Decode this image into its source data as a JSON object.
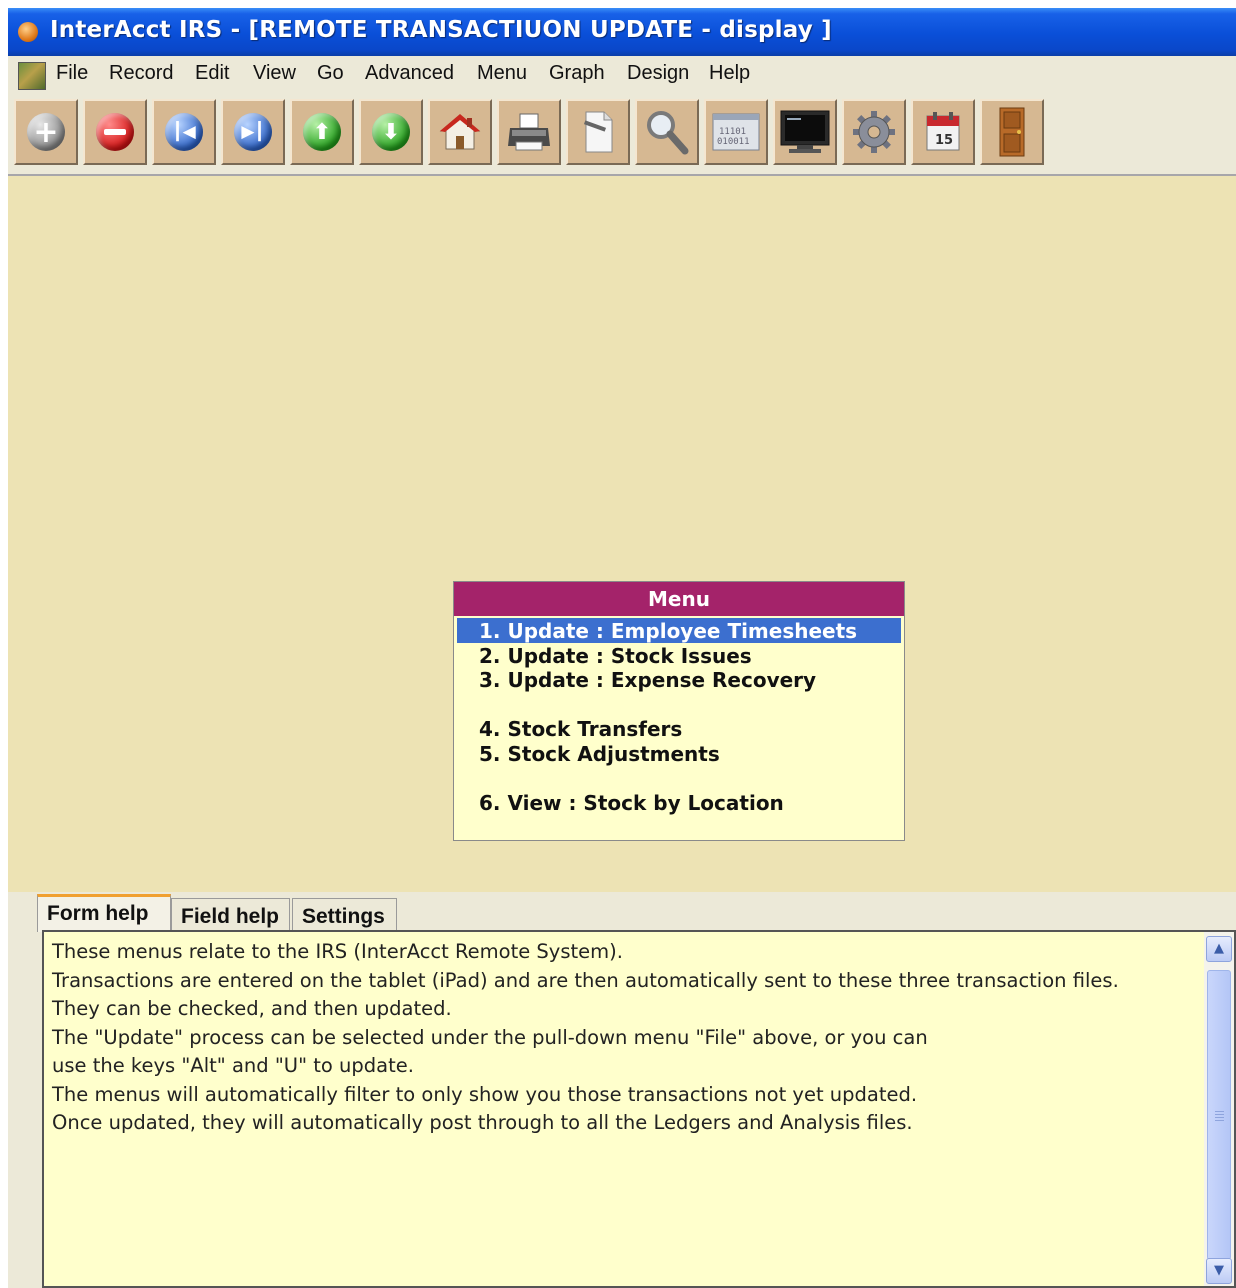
{
  "window": {
    "title": "InterAcct IRS - [REMOTE TRANSACTIUON UPDATE - display ]"
  },
  "menubar": {
    "items": [
      {
        "label": "File",
        "icon": null
      },
      {
        "label": "Record"
      },
      {
        "label": "Edit"
      },
      {
        "label": "View"
      },
      {
        "label": "Go"
      },
      {
        "label": "Advanced"
      },
      {
        "label": "Menu"
      },
      {
        "label": "Graph"
      },
      {
        "label": "Design"
      },
      {
        "label": "Help"
      }
    ]
  },
  "toolbar": {
    "buttons": [
      {
        "icon": "add-icon"
      },
      {
        "icon": "remove-icon"
      },
      {
        "icon": "first-record-icon"
      },
      {
        "icon": "last-record-icon"
      },
      {
        "icon": "previous-up-icon"
      },
      {
        "icon": "next-down-icon"
      },
      {
        "icon": "home-icon"
      },
      {
        "icon": "printer-icon"
      },
      {
        "icon": "document-icon"
      },
      {
        "icon": "search-magnifier-icon"
      },
      {
        "icon": "binary-data-icon"
      },
      {
        "icon": "monitor-icon"
      },
      {
        "icon": "gear-icon"
      },
      {
        "icon": "calendar-icon",
        "text": "15"
      },
      {
        "icon": "exit-door-icon"
      }
    ]
  },
  "menu_box": {
    "title": "Menu",
    "options": [
      "1. Update : Employee Timesheets",
      "2. Update : Stock Issues",
      "3. Update : Expense Recovery",
      "4. Stock Transfers",
      "5. Stock Adjustments",
      "6. View : Stock by Location"
    ],
    "selected_index": 0,
    "colors": {
      "header": "#a4236a",
      "selection": "#3c6fcf",
      "background": "#ffffcc"
    }
  },
  "tabs": [
    {
      "label": "Form help",
      "active": true
    },
    {
      "label": "Field help",
      "active": false
    },
    {
      "label": "Settings",
      "active": false
    }
  ],
  "help": {
    "lines": [
      "These menus relate to the IRS (InterAcct Remote System).",
      "",
      "Transactions are entered on the tablet (iPad) and are then automatically sent to these three transaction files.",
      "They can be checked, and then updated.",
      "",
      "The \"Update\" process can be selected under the pull-down menu \"File\" above, or you can",
      "use the keys \"Alt\" and \"U\" to update.",
      "",
      "The menus will automatically filter to only show you those transactions not yet updated.",
      "",
      "Once updated, they will automatically post through to all the Ledgers and Analysis files."
    ]
  },
  "colors": {
    "titlebar": "#0a4fd8",
    "workspace": "#ede3b4",
    "toolbar_button": "#d6b892"
  }
}
